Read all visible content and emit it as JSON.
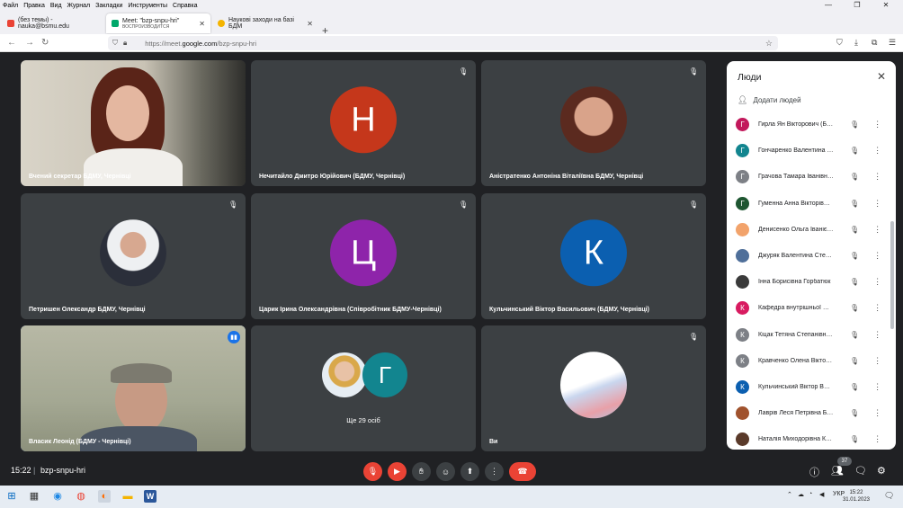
{
  "menu": [
    "Файл",
    "Правка",
    "Вид",
    "Журнал",
    "Закладки",
    "Инструменты",
    "Справка"
  ],
  "tabs": [
    {
      "title": "(без темы) - nauka@bsmu.edu",
      "active": false
    },
    {
      "title": "Meet: \"bzp-snpu-hri\"",
      "subtitle": "ВОСПРОИЗВОДИТСЯ",
      "active": true
    },
    {
      "title": "Наукові заходи на базі БДМ",
      "active": false
    }
  ],
  "url": {
    "prefix": "https://meet.",
    "domain": "google.com",
    "suffix": "/bzp-snpu-hri"
  },
  "tiles": [
    {
      "name": "Вчений секретар БДМУ, Чернівці",
      "type": "photo"
    },
    {
      "name": "Нечитайло Дмитро Юрійович (БДМУ, Чернівці)",
      "letter": "Н",
      "color": "#c5371b"
    },
    {
      "name": "Аністратенко Антоніна Віталіївна БДМУ, Чернівці",
      "type": "photo"
    },
    {
      "name": "Петришен Олександр БДМУ, Чернівці",
      "type": "photo"
    },
    {
      "name": "Царик Ірина Олександрівна (Співробітник БДМУ-Чернівці)",
      "letter": "Ц",
      "color": "#8e24aa"
    },
    {
      "name": "Кульчинський Віктор Васильович (БДМУ, Чернівці)",
      "letter": "К",
      "color": "#0b5fb0"
    },
    {
      "name": "Власик Леонід (БДМУ - Чернівці)",
      "type": "photo"
    },
    {
      "name": "Ще 29 осіб",
      "letter": "Г",
      "color": "#12858f"
    },
    {
      "name": "Ви",
      "type": "photo"
    }
  ],
  "panel": {
    "title": "Люди",
    "add_label": "Додати людей",
    "people": [
      {
        "initial": "Г",
        "name": "Гирла Ян Вікторович (Б…",
        "color": "#c2185b"
      },
      {
        "initial": "Г",
        "name": "Гончаренко Валентина …",
        "color": "#12858f"
      },
      {
        "initial": "Г",
        "name": "Грачова Тамара Іванівн…",
        "color": "#7d8086"
      },
      {
        "initial": "Г",
        "name": "Гуменна Анна Вікторів…",
        "color": "#1e5631"
      },
      {
        "initial": "",
        "name": "Денисенко Ольга Іваніє…",
        "color": "#f2a36b"
      },
      {
        "initial": "",
        "name": "Джуряк Валентина Сте…",
        "color": "#4f6f9a"
      },
      {
        "initial": "",
        "name": "Інна Борисівна Горбатюк",
        "color": "#3a3a3a"
      },
      {
        "initial": "К",
        "name": "Кафедра внутрішньої …",
        "color": "#d81b60"
      },
      {
        "initial": "К",
        "name": "Кіцак Тетяна Степанівн…",
        "color": "#7d8086"
      },
      {
        "initial": "К",
        "name": "Кравченко Олена Вікто…",
        "color": "#7d8086"
      },
      {
        "initial": "К",
        "name": "Кульчинський Віктор В…",
        "color": "#0b5fb0"
      },
      {
        "initial": "",
        "name": "Лаврів Леся Петрівна Б…",
        "color": "#a0522d"
      },
      {
        "initial": "",
        "name": "Наталія Миходорівна К…",
        "color": "#5a3a2a"
      }
    ]
  },
  "bottom": {
    "time": "15:22",
    "code": "bzp-snpu-hri",
    "participants_count": "37"
  },
  "taskbar": {
    "lang": "УКР",
    "time": "15:22",
    "date": "31.01.2023"
  }
}
